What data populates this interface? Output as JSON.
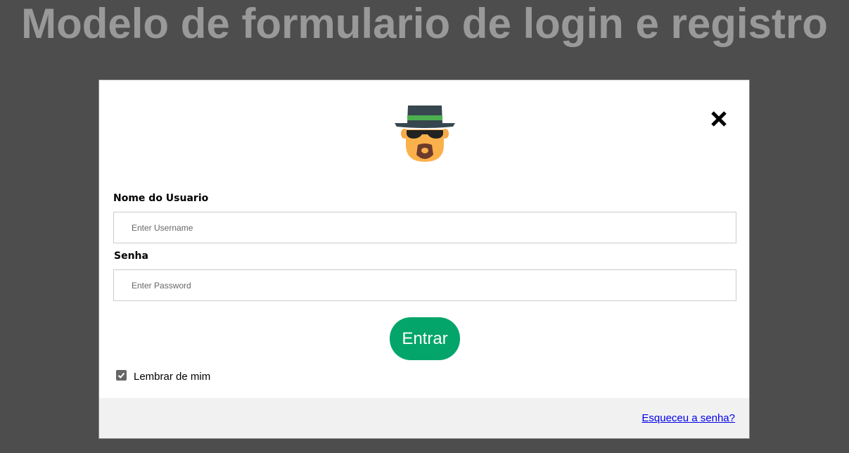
{
  "page": {
    "title": "Modelo de formulario de login e registro"
  },
  "modal": {
    "close_icon": "close-icon",
    "avatar_icon": "heisenberg-avatar-icon",
    "username": {
      "label": "Nome do Usuario",
      "placeholder": "Enter Username",
      "value": ""
    },
    "password": {
      "label": "Senha",
      "placeholder": "Enter Password",
      "value": ""
    },
    "submit_label": "Entrar",
    "remember": {
      "label": "Lembrar de mim",
      "checked": true
    },
    "footer": {
      "forgot_label": "Esqueceu a senha?"
    }
  },
  "colors": {
    "background": "#4d4d4d",
    "title": "#999999",
    "primary_button": "#04a56b",
    "footer": "#f1f1f1",
    "link": "#0000ee"
  }
}
